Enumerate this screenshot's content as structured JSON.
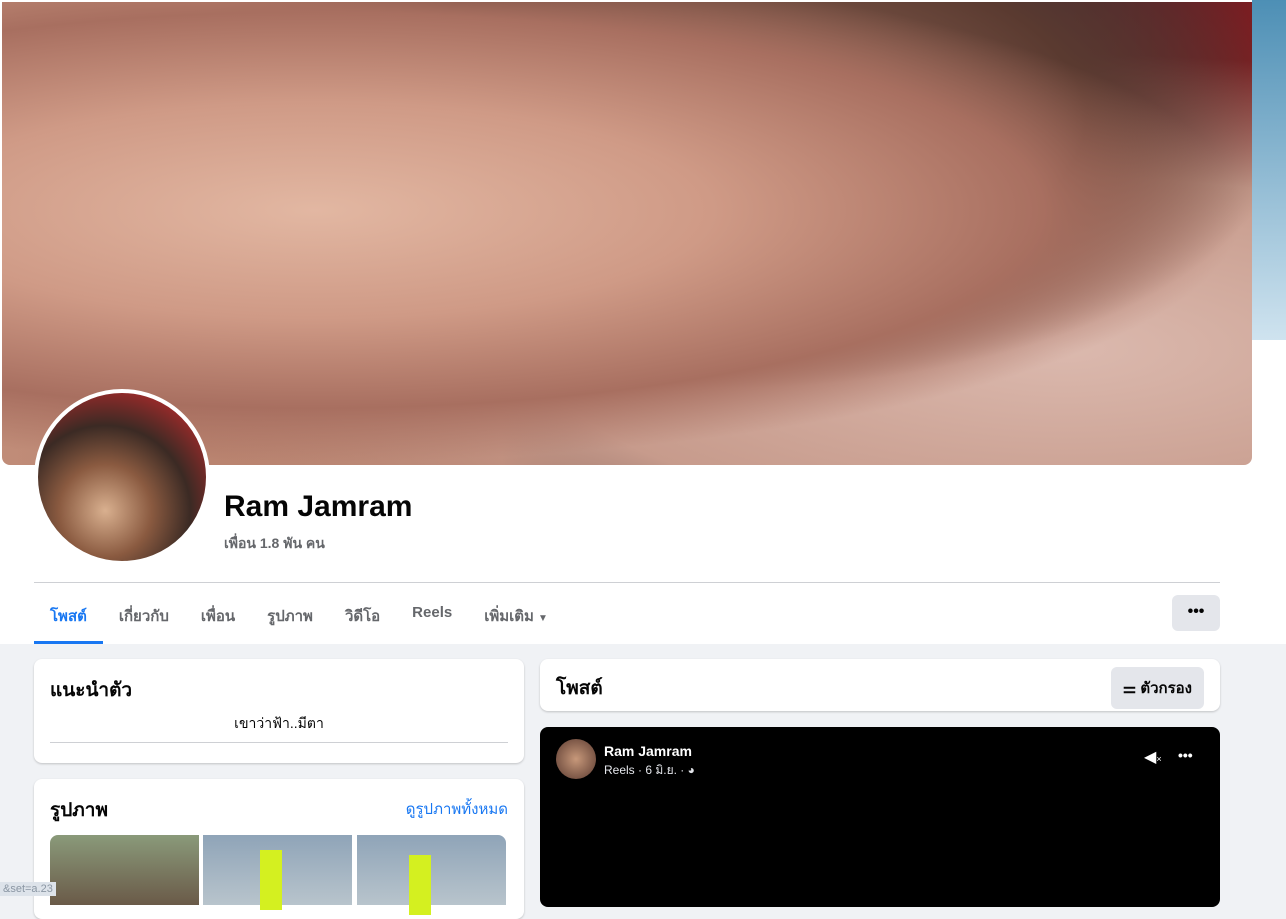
{
  "profile": {
    "name": "Ram Jamram",
    "friends": "เพื่อน 1.8 พัน คน"
  },
  "tabs": [
    "โพสต์",
    "เกี่ยวกับ",
    "เพื่อน",
    "รูปภาพ",
    "วิดีโอ",
    "Reels",
    "เพิ่มเติม"
  ],
  "more_menu": "•••",
  "intro": {
    "title": "แนะนำตัว",
    "bio": "เขาว่าฟ้า..มีตา"
  },
  "photos": {
    "title": "รูปภาพ",
    "see_all": "ดูรูปภาพทั้งหมด"
  },
  "posts": {
    "title": "โพสต์",
    "filter": "ตัวกรอง"
  },
  "post": {
    "author": "Ram Jamram",
    "meta": "Reels · 6 มิ.ย. ·",
    "menu": "•••"
  },
  "status_url": "&set=a.23"
}
